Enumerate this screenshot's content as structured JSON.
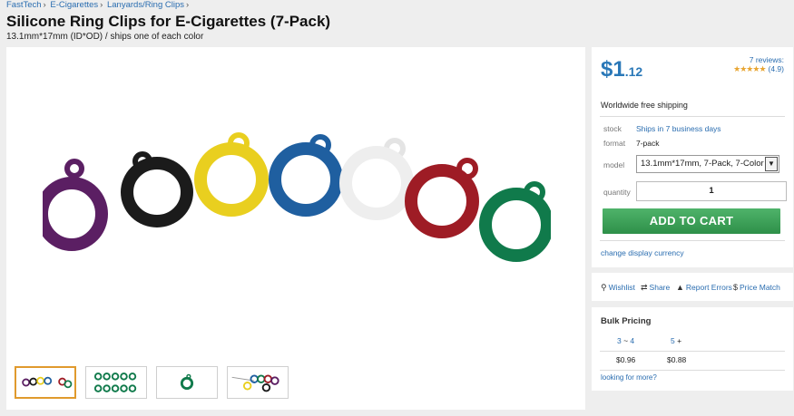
{
  "breadcrumb": {
    "items": [
      "FastTech",
      "E-Cigarettes",
      "Lanyards/Ring Clips"
    ],
    "separator": "›"
  },
  "product": {
    "title": "Silicone Ring Clips for E-Cigarettes (7-Pack)",
    "subtitle": "13.1mm*17mm (ID*OD) / ships one of each color",
    "ring_colors": [
      "#5b1f63",
      "#1b1b1b",
      "#e9cf1f",
      "#1f5fa0",
      "#f2f2f2",
      "#9e1c25",
      "#107a4b"
    ]
  },
  "thumbnails": {
    "count": 4,
    "active_index": 0,
    "accent_color": "#e09a2d"
  },
  "buy": {
    "price_dollars": "$1",
    "price_cents": ".12",
    "reviews_text": "7 reviews:",
    "stars": "★★★★★",
    "rating": "(4.9)",
    "shipping": "Worldwide free shipping",
    "stock_label": "stock",
    "stock_value": "Ships in 7 business days",
    "format_label": "format",
    "format_value": "7-pack",
    "model_label": "model",
    "model_value": "13.1mm*17mm, 7-Pack, 7-Color",
    "quantity_label": "quantity",
    "quantity_value": "1",
    "add_to_cart": "ADD TO CART",
    "change_currency": "change display currency",
    "price_color": "#2a78b8",
    "cart_color": "#3a9d55"
  },
  "actions": {
    "wishlist": "Wishlist",
    "share": "Share",
    "report": "Report Errors",
    "price_match": "Price Match"
  },
  "bulk": {
    "title": "Bulk Pricing",
    "tiers": [
      {
        "range_start": "3",
        "range_sep": " ~ ",
        "range_end": "4",
        "price": "$0.96"
      },
      {
        "range_start": "5",
        "range_sep": " +",
        "range_end": "",
        "price": "$0.88"
      }
    ],
    "more": "looking for more?"
  }
}
